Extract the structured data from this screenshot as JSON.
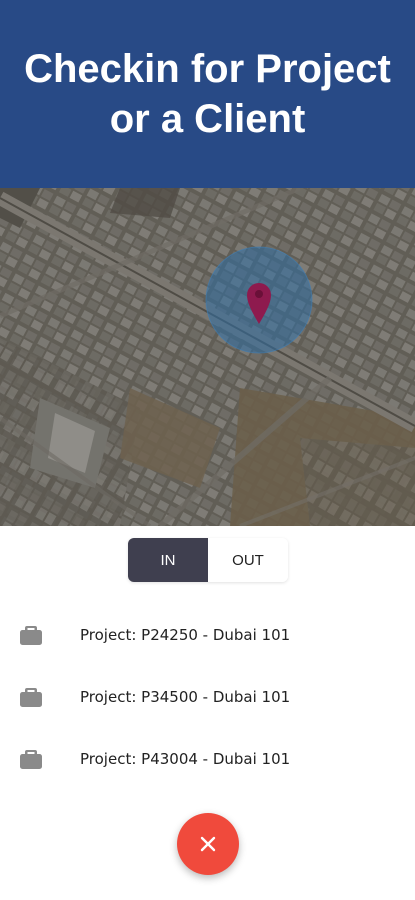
{
  "header": {
    "title_line1": "Checkin for Project",
    "title_line2": "or a Client",
    "background_color": "#284a86"
  },
  "map": {
    "pin_icon": "location-pin-icon",
    "pin_color": "#8e1a4e",
    "accuracy_circle_color": "#2f6fa5"
  },
  "toggle": {
    "in_label": "IN",
    "out_label": "OUT",
    "selected": "IN"
  },
  "projects": [
    {
      "label": "Project: P24250 - Dubai 101",
      "icon": "briefcase-icon"
    },
    {
      "label": "Project: P34500 - Dubai 101",
      "icon": "briefcase-icon"
    },
    {
      "label": "Project: P43004 - Dubai 101",
      "icon": "briefcase-icon"
    }
  ],
  "fab": {
    "icon": "close-icon",
    "color": "#f04a3c"
  }
}
